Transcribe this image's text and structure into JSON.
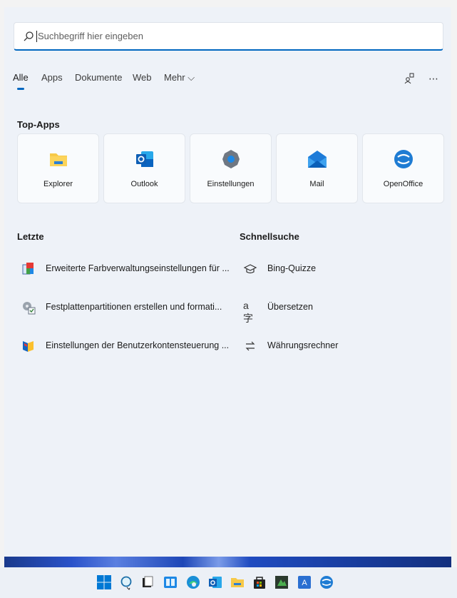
{
  "search": {
    "placeholder": "Suchbegriff hier eingeben"
  },
  "tabs": [
    {
      "label": "Alle"
    },
    {
      "label": "Apps"
    },
    {
      "label": "Dokumente"
    },
    {
      "label": "Web"
    },
    {
      "label": "Mehr ⌵"
    }
  ],
  "top_apps": {
    "heading": "Top-Apps",
    "items": [
      {
        "label": "Explorer",
        "icon": "folder-icon"
      },
      {
        "label": "Outlook",
        "icon": "outlook-icon"
      },
      {
        "label": "Einstellungen",
        "icon": "gear-icon"
      },
      {
        "label": "Mail",
        "icon": "mail-icon"
      },
      {
        "label": "OpenOffice",
        "icon": "openoffice-icon"
      }
    ]
  },
  "recent": {
    "heading": "Letzte",
    "items": [
      {
        "label": "Erweiterte Farbverwaltungseinstellungen für ..."
      },
      {
        "label": "Festplattenpartitionen erstellen und formati..."
      },
      {
        "label": "Einstellungen der Benutzerkontensteuerung ..."
      }
    ]
  },
  "quick": {
    "heading": "Schnellsuche",
    "items": [
      {
        "label": "Bing-Quizze",
        "icon": "graduation-cap-icon"
      },
      {
        "label": "Übersetzen",
        "icon": "translate-icon"
      },
      {
        "label": "Währungsrechner",
        "icon": "exchange-icon"
      }
    ]
  },
  "colors": {
    "accent": "#0067c0",
    "panel": "#eef2f8",
    "taskbar": "#ecf0f6"
  }
}
